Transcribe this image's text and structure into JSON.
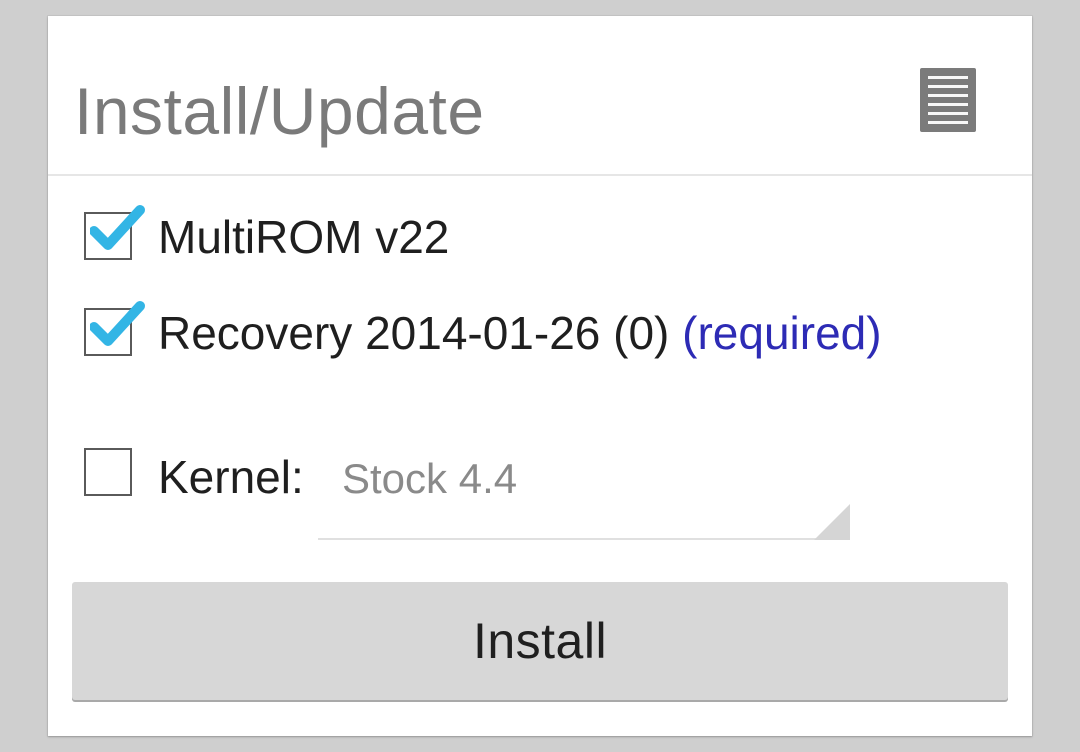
{
  "dialog": {
    "title": "Install/Update",
    "menu_icon": "menu-icon"
  },
  "options": [
    {
      "name": "MultiROM v22",
      "checked": true
    },
    {
      "name": "Recovery 2014-01-26 (0)",
      "note": "(required)",
      "checked": true
    },
    {
      "name": "Kernel:",
      "checked": false,
      "selected_value": "Stock 4.4"
    }
  ],
  "colors": {
    "background": "#cfcfcf",
    "card": "#ffffff",
    "title": "#7a7a7a",
    "label": "#1f1f1f",
    "required": "#2d2bb5",
    "checkmark": "#33b5e5",
    "button": "#d7d7d7"
  },
  "actions": {
    "install_label": "Install"
  }
}
